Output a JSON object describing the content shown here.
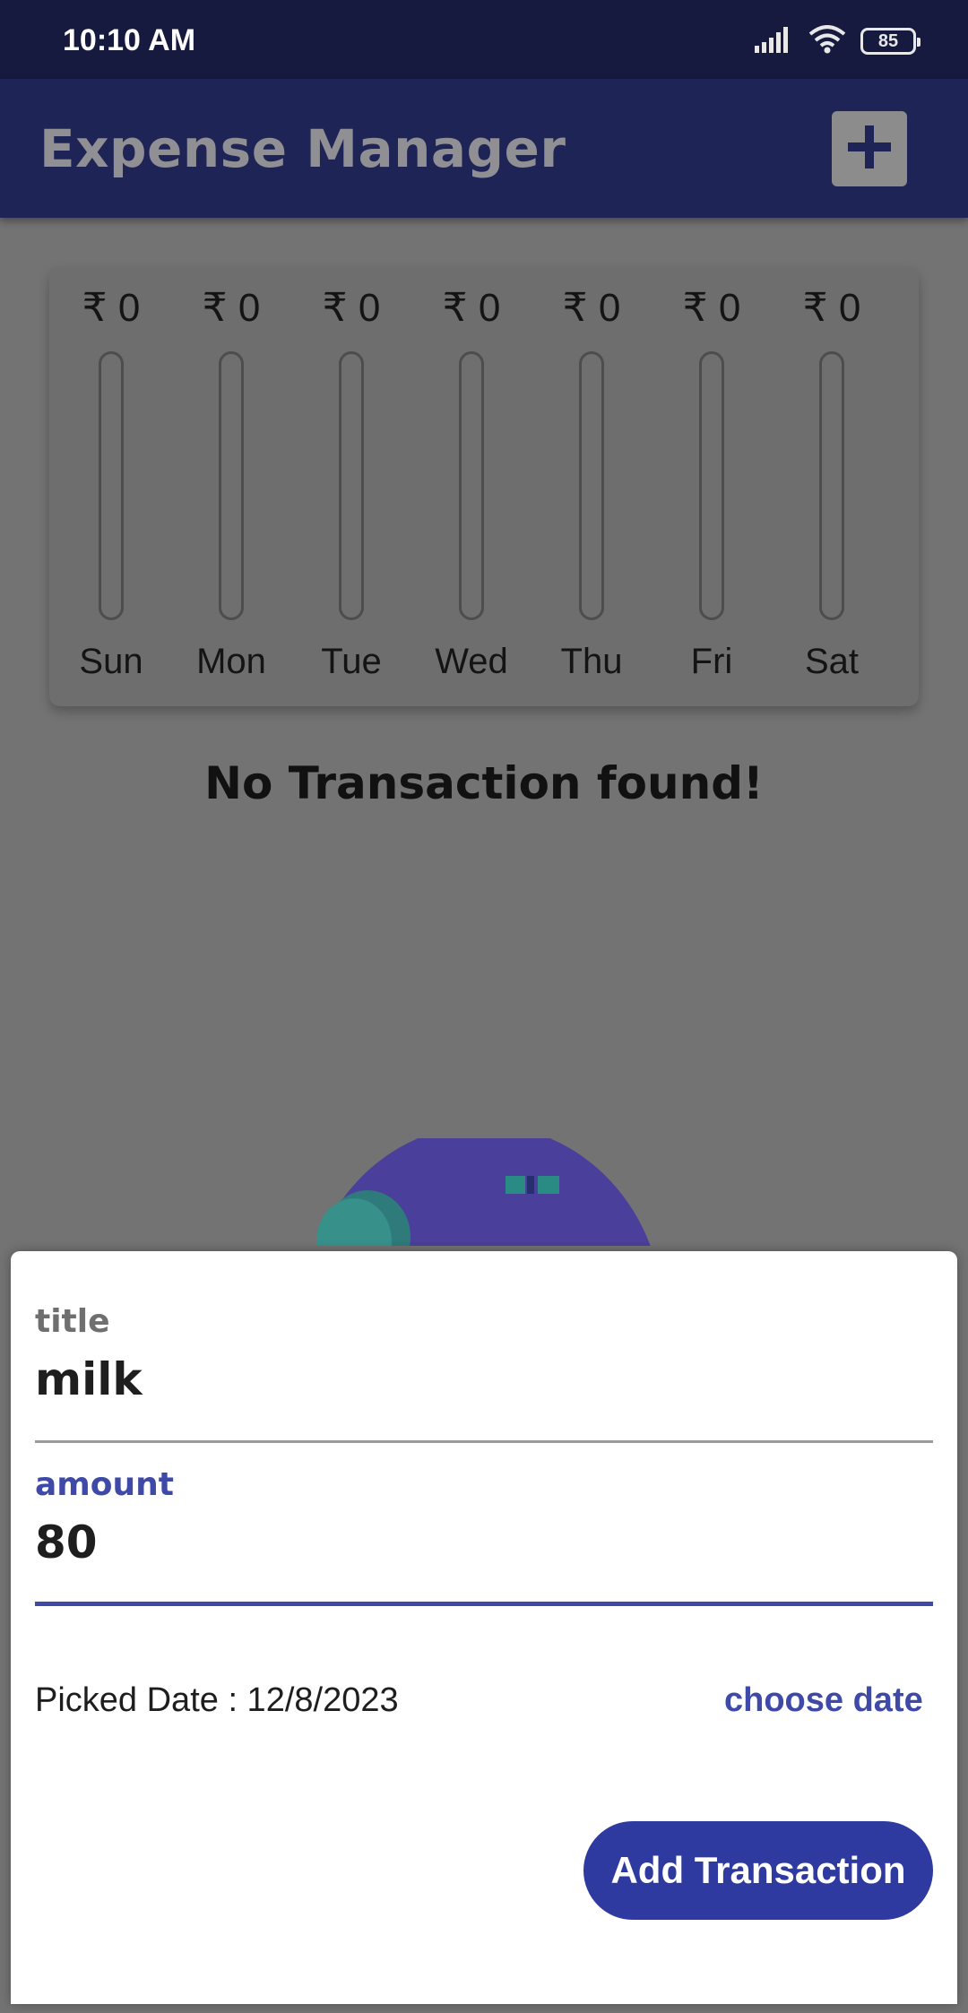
{
  "status_bar": {
    "time": "10:10 AM",
    "battery": "85"
  },
  "app_bar": {
    "title": "Expense Manager",
    "add_icon": "plus-icon"
  },
  "chart": {
    "currency_symbol": "₹",
    "bars": [
      {
        "day": "Sun",
        "amount": "₹ 0",
        "fill_fraction": 0
      },
      {
        "day": "Mon",
        "amount": "₹ 0",
        "fill_fraction": 0
      },
      {
        "day": "Tue",
        "amount": "₹ 0",
        "fill_fraction": 0
      },
      {
        "day": "Wed",
        "amount": "₹ 0",
        "fill_fraction": 0
      },
      {
        "day": "Thu",
        "amount": "₹ 0",
        "fill_fraction": 0
      },
      {
        "day": "Fri",
        "amount": "₹ 0",
        "fill_fraction": 0
      },
      {
        "day": "Sat",
        "amount": "₹ 0",
        "fill_fraction": 0
      }
    ]
  },
  "empty_state": {
    "message": "No Transaction found!"
  },
  "sheet": {
    "title_label": "title",
    "title_value": "milk",
    "amount_label": "amount",
    "amount_value": "80",
    "picked_date": "Picked Date : 12/8/2023",
    "choose_date": "choose date",
    "submit_label": "Add Transaction"
  },
  "colors": {
    "primary": "#2f3aa0",
    "accent_label": "#3f4aa8",
    "status_bar": "#151a3e"
  }
}
